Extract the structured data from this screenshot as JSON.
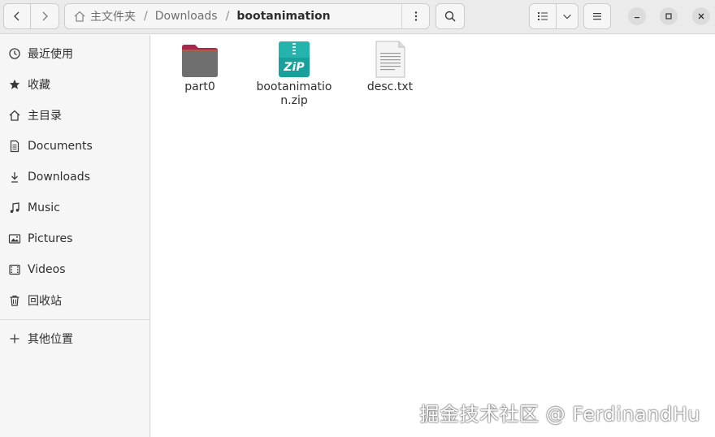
{
  "pathbar": {
    "home_label": "主文件夹",
    "separator": "/",
    "segment": "Downloads",
    "current": "bootanimation"
  },
  "sidebar": {
    "items": [
      {
        "label": "最近使用",
        "icon": "clock-icon"
      },
      {
        "label": "收藏",
        "icon": "star-icon"
      },
      {
        "label": "主目录",
        "icon": "home-icon"
      },
      {
        "label": "Documents",
        "icon": "document-icon"
      },
      {
        "label": "Downloads",
        "icon": "download-icon"
      },
      {
        "label": "Music",
        "icon": "music-icon"
      },
      {
        "label": "Pictures",
        "icon": "picture-icon"
      },
      {
        "label": "Videos",
        "icon": "video-icon"
      },
      {
        "label": "回收站",
        "icon": "trash-icon"
      },
      {
        "label": "其他位置",
        "icon": "plus-icon"
      }
    ]
  },
  "files": [
    {
      "name": "part0",
      "type": "folder"
    },
    {
      "name": "bootanimation.zip",
      "type": "zip",
      "badge": "ZiP"
    },
    {
      "name": "desc.txt",
      "type": "text"
    }
  ],
  "watermark": "掘金技术社区 @ FerdinandHu",
  "colors": {
    "folder_top": "#a7284d",
    "folder_body": "#6f6f6f",
    "zip_accent": "#1aa09a"
  }
}
